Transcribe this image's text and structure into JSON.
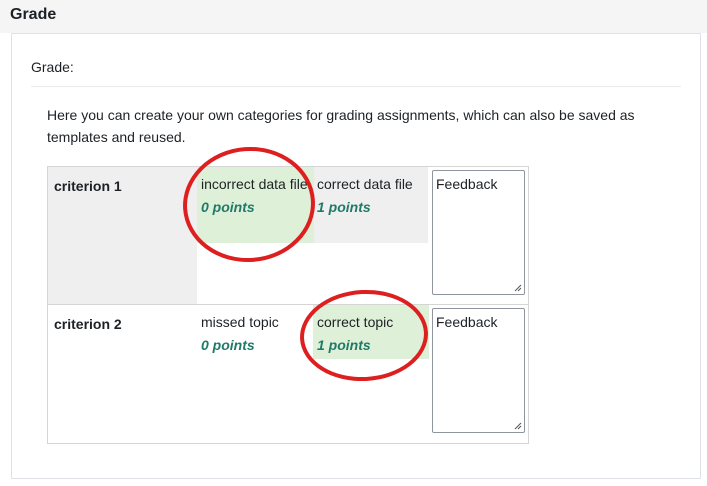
{
  "section": {
    "title": "Grade"
  },
  "panel": {
    "label": "Grade:",
    "intro": "Here you can create your own categories for grading assignments, which can also be saved as templates and reused."
  },
  "rubric": {
    "criteria": [
      {
        "name": "criterion 1",
        "levels": [
          {
            "label": "incorrect data file",
            "points": "0 points",
            "selected": true
          },
          {
            "label": "correct data file",
            "points": "1 points",
            "selected": false
          }
        ],
        "feedback_placeholder": "Feedback"
      },
      {
        "name": "criterion 2",
        "levels": [
          {
            "label": "missed topic",
            "points": "0 points",
            "selected": false
          },
          {
            "label": "correct topic",
            "points": "1 points",
            "selected": true
          }
        ],
        "feedback_placeholder": "Feedback"
      }
    ]
  },
  "colors": {
    "selected_bg": "#dff0d8",
    "points_text": "#1f7a6a",
    "annotation_circle": "#dd1f1f"
  }
}
